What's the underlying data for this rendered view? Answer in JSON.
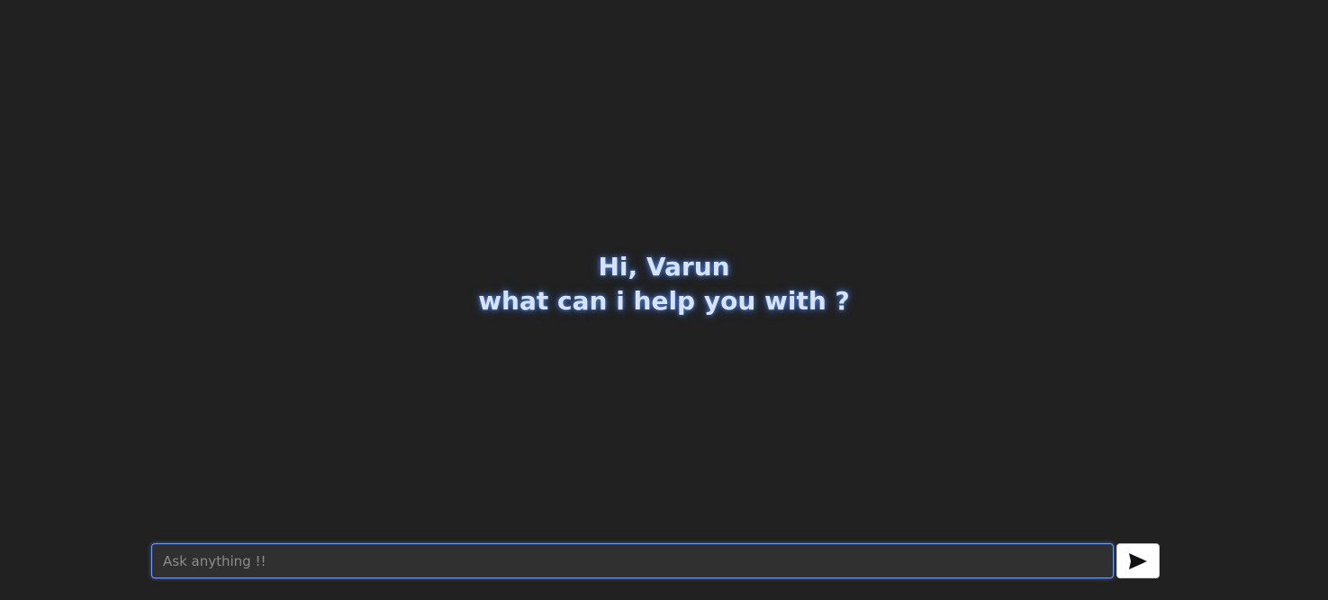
{
  "greeting": {
    "line1": "Hi, Varun",
    "line2": "what can i help you with ?"
  },
  "composer": {
    "placeholder": "Ask anything !!",
    "value": "",
    "send_icon": "send-icon"
  },
  "colors": {
    "background": "#212121",
    "greeting_text": "#d7e3f4",
    "glow": "#5a96ff",
    "input_background": "#303030",
    "input_border": "#7a9ff0",
    "send_button_background": "#ffffff"
  }
}
